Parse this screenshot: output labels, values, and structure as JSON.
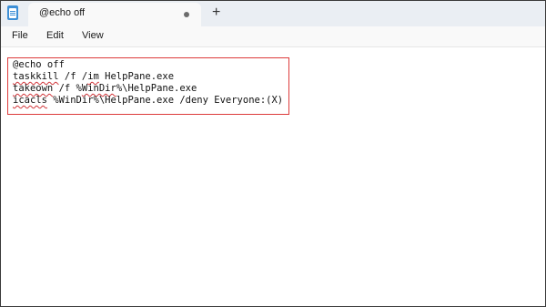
{
  "window": {
    "tab_title": "@echo off",
    "new_tab_label": "+"
  },
  "menu": {
    "file": "File",
    "edit": "Edit",
    "view": "View"
  },
  "editor": {
    "lines": [
      [
        {
          "t": "@echo off",
          "s": false
        }
      ],
      [
        {
          "t": "taskkill",
          "s": true
        },
        {
          "t": " /f /",
          "s": false
        },
        {
          "t": "im",
          "s": true
        },
        {
          "t": " HelpPane.exe",
          "s": false
        }
      ],
      [
        {
          "t": "takeown",
          "s": true
        },
        {
          "t": " /f %",
          "s": false
        },
        {
          "t": "WinDir",
          "s": true
        },
        {
          "t": "%\\HelpPane.exe",
          "s": false
        }
      ],
      [
        {
          "t": "icacls",
          "s": true
        },
        {
          "t": " %WinDir%\\HelpPane.exe /deny Everyone:(X)",
          "s": false
        }
      ]
    ]
  },
  "colors": {
    "highlight_border": "#dd3b3b",
    "spellcheck_underline": "#d13438"
  },
  "icons": {
    "app": "notepad-icon",
    "unsaved": "unsaved-dot-icon",
    "add_tab": "plus-icon"
  }
}
